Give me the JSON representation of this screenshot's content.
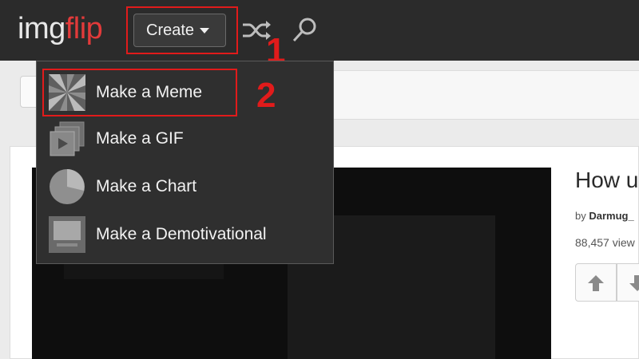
{
  "header": {
    "logo_part1": "img",
    "logo_part2": "flip",
    "create_label": "Create",
    "annotation_1": "1"
  },
  "menu": {
    "items": [
      {
        "label": "Make a Meme",
        "icon": "meme-icon"
      },
      {
        "label": "Make a GIF",
        "icon": "gif-icon"
      },
      {
        "label": "Make a Chart",
        "icon": "chart-icon"
      },
      {
        "label": "Make a Demotivational",
        "icon": "demotivational-icon"
      }
    ],
    "annotation_2": "2"
  },
  "content": {
    "title": "How u",
    "by_prefix": "by",
    "author": "Darmug_",
    "views": "88,457 view"
  },
  "colors": {
    "header_bg": "#2b2b2b",
    "logo_accent": "#e23a3a",
    "annotation": "#e11b1b",
    "menu_bg": "#2f2f2f"
  }
}
